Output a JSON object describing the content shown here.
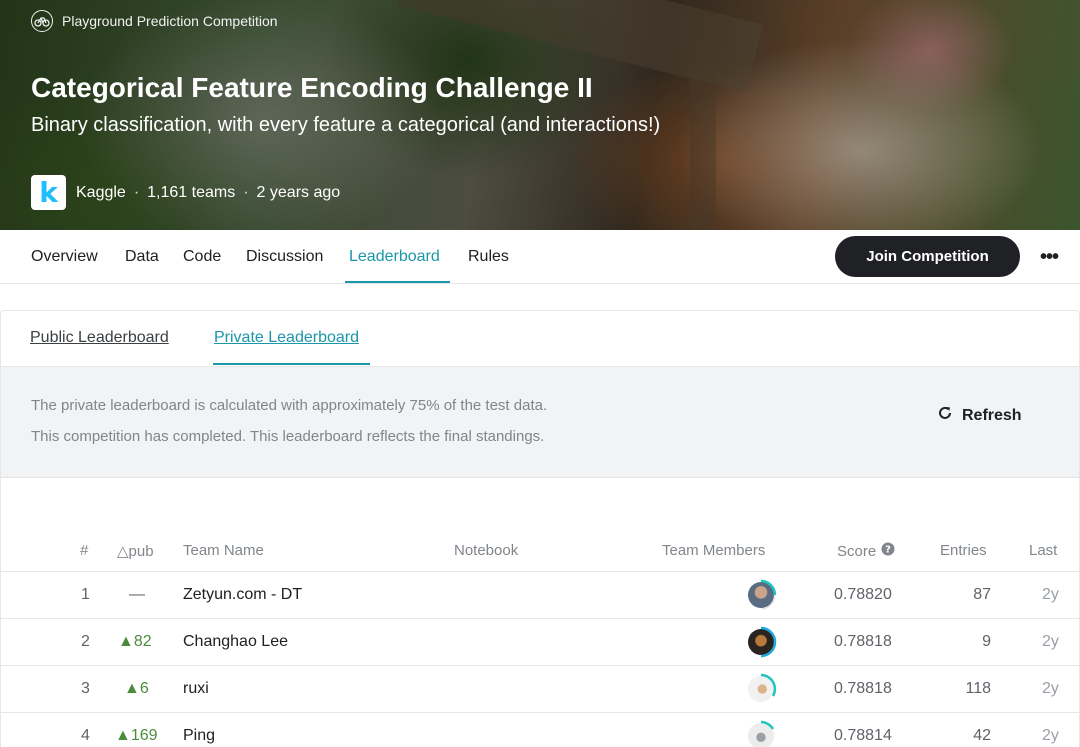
{
  "hero": {
    "competition_type": "Playground Prediction Competition",
    "title": "Categorical Feature Encoding Challenge II",
    "subtitle": "Binary classification, with every feature a categorical (and interactions!)",
    "host": "Kaggle",
    "teams": "1,161 teams",
    "ago": "2 years ago",
    "separator": "·"
  },
  "nav": {
    "tabs": [
      {
        "label": "Overview"
      },
      {
        "label": "Data"
      },
      {
        "label": "Code"
      },
      {
        "label": "Discussion"
      },
      {
        "label": "Leaderboard"
      },
      {
        "label": "Rules"
      }
    ],
    "active_tab": "Leaderboard",
    "join_label": "Join Competition",
    "more_label": "•••"
  },
  "leaderboard": {
    "tabs": [
      {
        "label": "Public Leaderboard"
      },
      {
        "label": "Private Leaderboard"
      }
    ],
    "active_tab": "Private Leaderboard",
    "info_lines": [
      "The private leaderboard is calculated with approximately 75% of the test data.",
      "This competition has completed. This leaderboard reflects the final standings."
    ],
    "refresh_label": "Refresh",
    "columns": {
      "rank": "#",
      "delta": "△pub",
      "team": "Team Name",
      "notebook": "Notebook",
      "members": "Team Members",
      "score": "Score",
      "entries": "Entries",
      "last": "Last"
    },
    "rows": [
      {
        "rank": "1",
        "delta": "—",
        "delta_up": false,
        "team": "Zetyun.com - DT",
        "score": "0.78820",
        "entries": "87",
        "last": "2y"
      },
      {
        "rank": "2",
        "delta": "▲82",
        "delta_up": true,
        "team": "Changhao Lee",
        "score": "0.78818",
        "entries": "9",
        "last": "2y"
      },
      {
        "rank": "3",
        "delta": "▲6",
        "delta_up": true,
        "team": "ruxi",
        "score": "0.78818",
        "entries": "118",
        "last": "2y"
      },
      {
        "rank": "4",
        "delta": "▲169",
        "delta_up": true,
        "team": "Ping",
        "score": "0.78814",
        "entries": "42",
        "last": "2y"
      }
    ]
  },
  "colors": {
    "accent": "#1a97a8",
    "up": "#4b8b3b",
    "kaggle_blue": "#20beff",
    "progress_ring": "#20c5c0"
  },
  "icons": {
    "competition_type": "bicycle-icon",
    "refresh": "refresh-icon",
    "score_help": "help-circle-icon",
    "more": "more-horizontal-icon"
  }
}
